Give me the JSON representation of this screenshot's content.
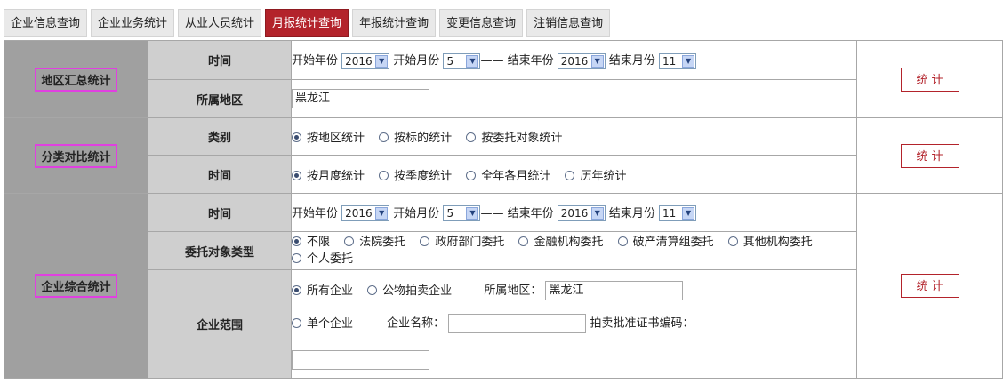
{
  "tabs": [
    "企业信息查询",
    "企业业务统计",
    "从业人员统计",
    "月报统计查询",
    "年报统计查询",
    "变更信息查询",
    "注销信息查询"
  ],
  "sections": {
    "region": {
      "label": "地区汇总统计",
      "time_label": "时间",
      "area_label": "所属地区",
      "start_year_label": "开始年份",
      "start_year": "2016",
      "start_month_label": "开始月份",
      "start_month": "5",
      "dash": "——",
      "end_year_label": "结束年份",
      "end_year": "2016",
      "end_month_label": "结束月份",
      "end_month": "11",
      "area_value": "黑龙江",
      "button": "统计"
    },
    "category": {
      "label": "分类对比统计",
      "type_label": "类别",
      "time_label": "时间",
      "type_options": [
        "按地区统计",
        "按标的统计",
        "按委托对象统计"
      ],
      "time_options": [
        "按月度统计",
        "按季度统计",
        "全年各月统计",
        "历年统计"
      ],
      "button": "统计"
    },
    "enterprise": {
      "label": "企业综合统计",
      "time_label": "时间",
      "start_year_label": "开始年份",
      "start_year": "2016",
      "start_month_label": "开始月份",
      "start_month": "5",
      "dash": "——",
      "end_year_label": "结束年份",
      "end_year": "2016",
      "end_month_label": "结束月份",
      "end_month": "11",
      "client_type_label": "委托对象类型",
      "client_options": [
        "不限",
        "法院委托",
        "政府部门委托",
        "金融机构委托",
        "破产清算组委托",
        "其他机构委托",
        "个人委托"
      ],
      "scope_label": "企业范围",
      "scope_all": "所有企业",
      "scope_public": "公物拍卖企业",
      "area_label": "所属地区：",
      "area_value": "黑龙江",
      "scope_single": "单个企业",
      "company_name_label": "企业名称：",
      "company_name_value": "",
      "license_label": "拍卖批准证书编码：",
      "license_value": "",
      "button": "统计"
    }
  }
}
